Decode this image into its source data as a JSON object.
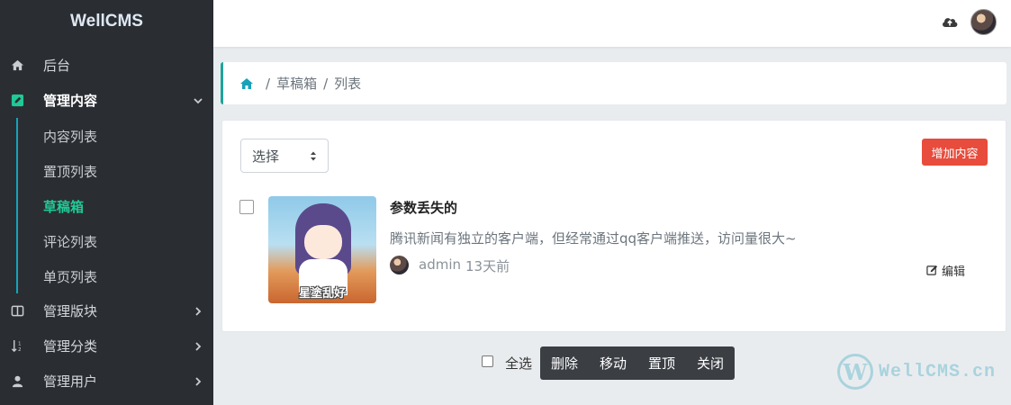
{
  "brand": "WellCMS",
  "sidebar": {
    "items": [
      {
        "label": "后台",
        "icon": "home-icon"
      },
      {
        "label": "管理内容",
        "icon": "edit-square-icon",
        "expanded": true
      },
      {
        "label": "管理版块",
        "icon": "columns-icon"
      },
      {
        "label": "管理分类",
        "icon": "sort-icon"
      },
      {
        "label": "管理用户",
        "icon": "user-icon"
      }
    ],
    "sub_items": [
      {
        "label": "内容列表"
      },
      {
        "label": "置顶列表"
      },
      {
        "label": "草稿箱",
        "active": true
      },
      {
        "label": "评论列表"
      },
      {
        "label": "单页列表"
      }
    ],
    "accent_color": "#20c997"
  },
  "breadcrumb": {
    "items": [
      "草稿箱",
      "列表"
    ],
    "separator": "/"
  },
  "toolbar": {
    "select_placeholder": "选择",
    "add_button": "增加内容",
    "add_button_color": "#e74c3c"
  },
  "posts": [
    {
      "title": "参数丢失的",
      "description": "腾讯新闻有独立的客户端，但经常通过qq客户端推送，访问量很大~",
      "author": "admin",
      "time": "13天前",
      "thumbnail_caption": "星塗乱好",
      "edit_label": "编辑"
    }
  ],
  "bottom": {
    "select_all": "全选",
    "actions": [
      "删除",
      "移动",
      "置顶",
      "关闭"
    ]
  },
  "watermark": {
    "logo": "W",
    "text": "WellCMS.cn"
  }
}
